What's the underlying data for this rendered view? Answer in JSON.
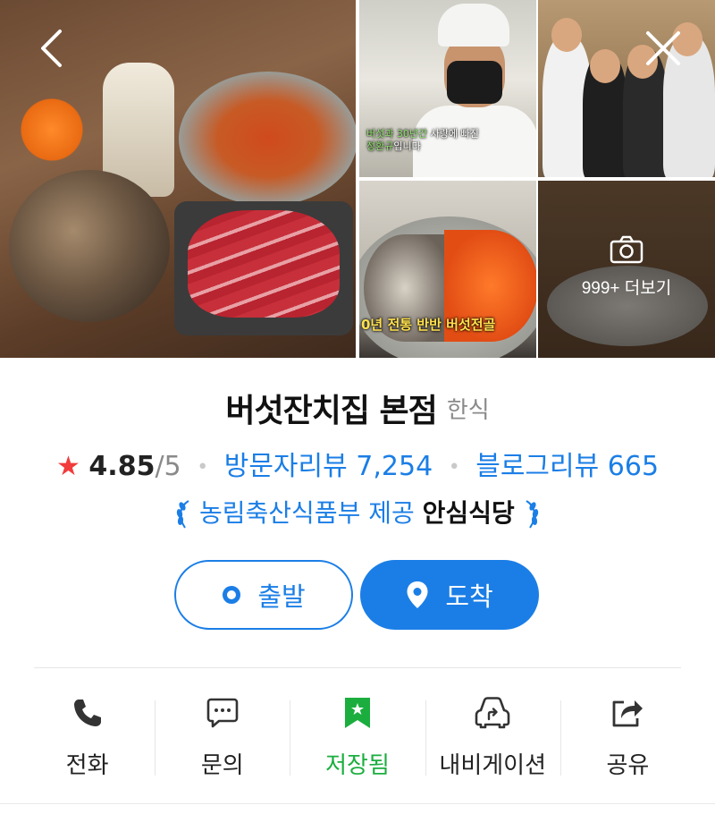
{
  "gallery": {
    "chef_caption_line1_white": "버섯과 30년간",
    "chef_caption_line1_rest": " 사랑에 빠진",
    "chef_caption_line2": "정환규",
    "chef_caption_line2_rest": "입니다",
    "pot_caption": "0년 전통 반반 버섯전골",
    "more_label": "999+ 더보기"
  },
  "place": {
    "name": "버섯잔치집 본점",
    "category": "한식"
  },
  "stats": {
    "star": "★",
    "rating": "4.85",
    "rating_max": "/5",
    "visitor_reviews": "방문자리뷰 7,254",
    "blog_reviews": "블로그리뷰 665"
  },
  "certification": {
    "provider": "농림축산식품부 제공",
    "name": "안심식당"
  },
  "buttons": {
    "start": "출발",
    "arrive": "도착"
  },
  "actions": [
    {
      "label": "전화",
      "icon": "phone-icon"
    },
    {
      "label": "문의",
      "icon": "chat-icon"
    },
    {
      "label": "저장됨",
      "icon": "bookmark-icon"
    },
    {
      "label": "내비게이션",
      "icon": "car-navigation-icon"
    },
    {
      "label": "공유",
      "icon": "share-icon"
    }
  ],
  "colors": {
    "accent": "#1b7ee6",
    "star": "#f23b3b",
    "saved": "#1bae3f"
  }
}
